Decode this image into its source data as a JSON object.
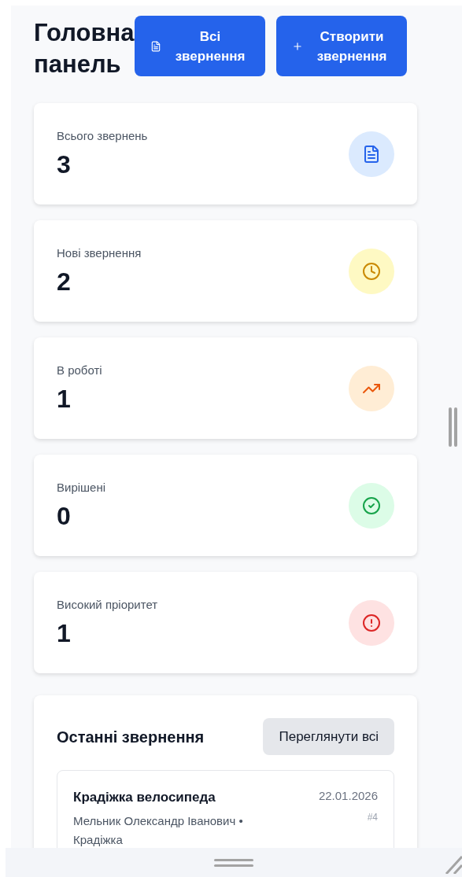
{
  "header": {
    "title": "Головна панель",
    "buttons": [
      {
        "kind": "list",
        "label": "Всі звернення"
      },
      {
        "kind": "add",
        "label": "Створити звернення"
      }
    ]
  },
  "stats": [
    {
      "kind": "total",
      "label": "Всього звернень",
      "value": "3"
    },
    {
      "kind": "new",
      "label": "Нові звернення",
      "value": "2"
    },
    {
      "kind": "in_progress",
      "label": "В роботі",
      "value": "1"
    },
    {
      "kind": "resolved",
      "label": "Вирішені",
      "value": "0"
    },
    {
      "kind": "high_priority",
      "label": "Високий пріоритет",
      "value": "1"
    }
  ],
  "recent": {
    "title": "Останні звернення",
    "view_all": "Переглянути всі",
    "items": [
      {
        "title": "Крадіжка велосипеда",
        "meta": "Мельник Олександр Іванович • Крадіжка",
        "date": "22.01.2026",
        "number": "#4"
      }
    ]
  }
}
